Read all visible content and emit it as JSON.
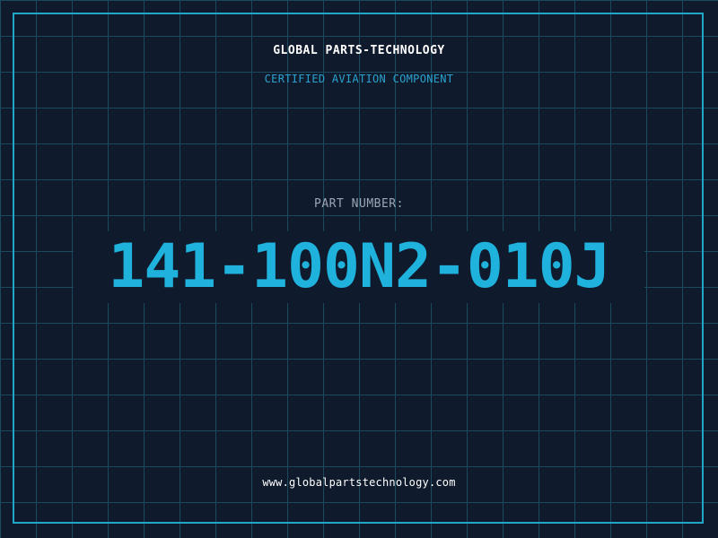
{
  "header": {
    "company_name": "GLOBAL PARTS-TECHNOLOGY",
    "tagline": "CERTIFIED AVIATION COMPONENT"
  },
  "part": {
    "label": "PART NUMBER:",
    "number": "141-100N2-010J"
  },
  "footer": {
    "website": "www.globalpartstechnology.com"
  },
  "colors": {
    "background": "#0f1a2c",
    "grid": "#1c4a5c",
    "accent": "#1fb2dd",
    "frame": "#1fa6c9"
  }
}
